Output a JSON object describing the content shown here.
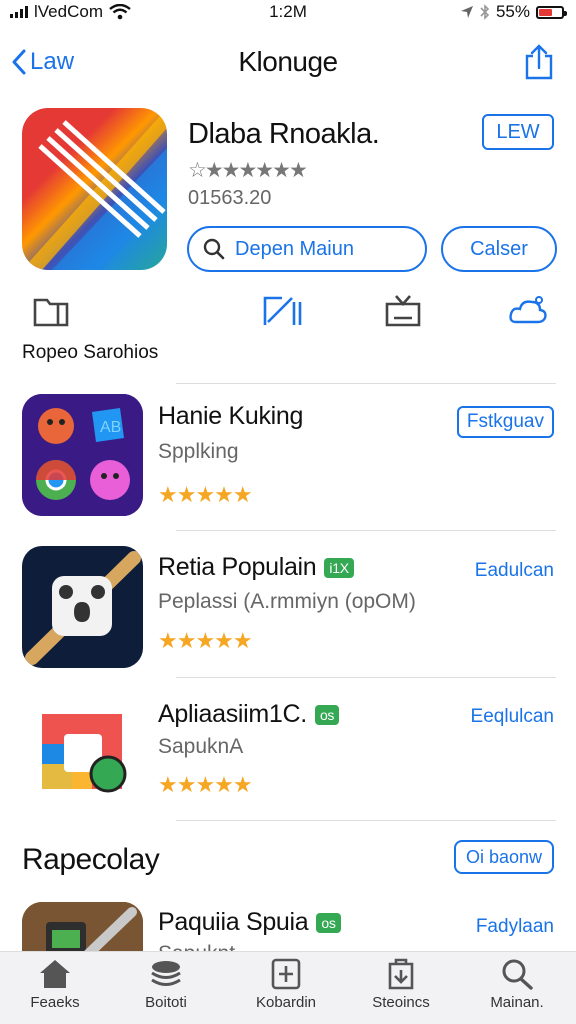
{
  "status": {
    "carrier": "lVedCom",
    "time": "1:2M",
    "battery": "55%"
  },
  "nav": {
    "back_label": "Law",
    "title": "Klonuge"
  },
  "hero": {
    "name": "Dlaba Rnoakla.",
    "stars": "☆★★★★★★",
    "size": "01563.20",
    "get_label": "LEW",
    "search_label": "Depen Maiun",
    "cancel_label": "Calser"
  },
  "section1": {
    "title": "Ropeo Sarohios"
  },
  "apps": [
    {
      "name": "Hanie Kuking",
      "sub": "Spplking",
      "stars": "★★★★★",
      "action": "Fstkguav",
      "badge": ""
    },
    {
      "name": "Retia Populain",
      "sub": "Peplassi (A.rmmiyn (opOM)",
      "stars": "★★★★★",
      "action": "Eadulcan",
      "badge": "i1X"
    },
    {
      "name": "Apliaasiim1C.",
      "sub": "SapuknA",
      "stars": "★★★★★",
      "action": "Eeqlulcan",
      "badge": "os"
    },
    {
      "name": "Paquiia Spuia",
      "sub": "Sapuknt",
      "stars": "",
      "action": "Fadylaan",
      "badge": "os"
    }
  ],
  "section2": {
    "title": "Rapecolay",
    "button": "Oi baonw"
  },
  "tabs": [
    {
      "label": "Feaeks",
      "icon": "home-icon"
    },
    {
      "label": "Boitoti",
      "icon": "layers-icon"
    },
    {
      "label": "Kobardin",
      "icon": "plus-box-icon"
    },
    {
      "label": "Steoincs",
      "icon": "inbox-icon"
    },
    {
      "label": "Mainan.",
      "icon": "search-icon"
    }
  ],
  "colors": {
    "accent": "#1a73e8",
    "star": "#f5a623",
    "badge": "#34a853"
  }
}
